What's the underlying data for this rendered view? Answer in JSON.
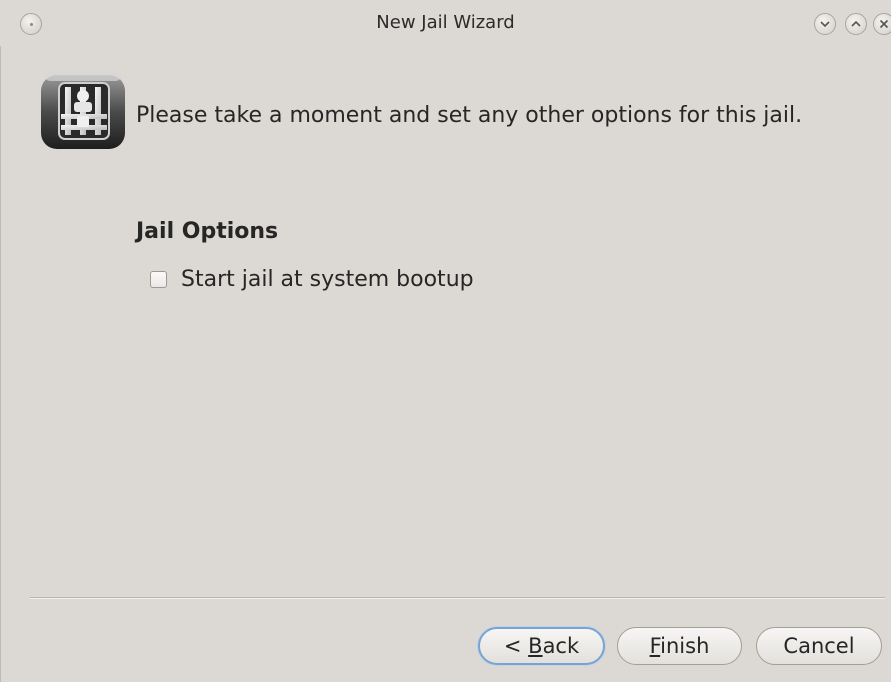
{
  "window": {
    "title": "New Jail Wizard",
    "controls": [
      "minimize-icon",
      "maximize-icon",
      "close-icon"
    ]
  },
  "page": {
    "intro": "Please take a moment and set any other options for this jail.",
    "section_title": "Jail Options",
    "options": [
      {
        "label": "Start jail at system bootup",
        "checked": false
      }
    ]
  },
  "buttons": {
    "back": {
      "prefix": "< ",
      "mnemonic": "B",
      "rest": "ack"
    },
    "finish": {
      "prefix": "",
      "mnemonic": "F",
      "rest": "inish"
    },
    "cancel": {
      "label": "Cancel"
    }
  },
  "colors": {
    "background": "#dcd8d3",
    "focus_border": "#7aa3cf"
  }
}
